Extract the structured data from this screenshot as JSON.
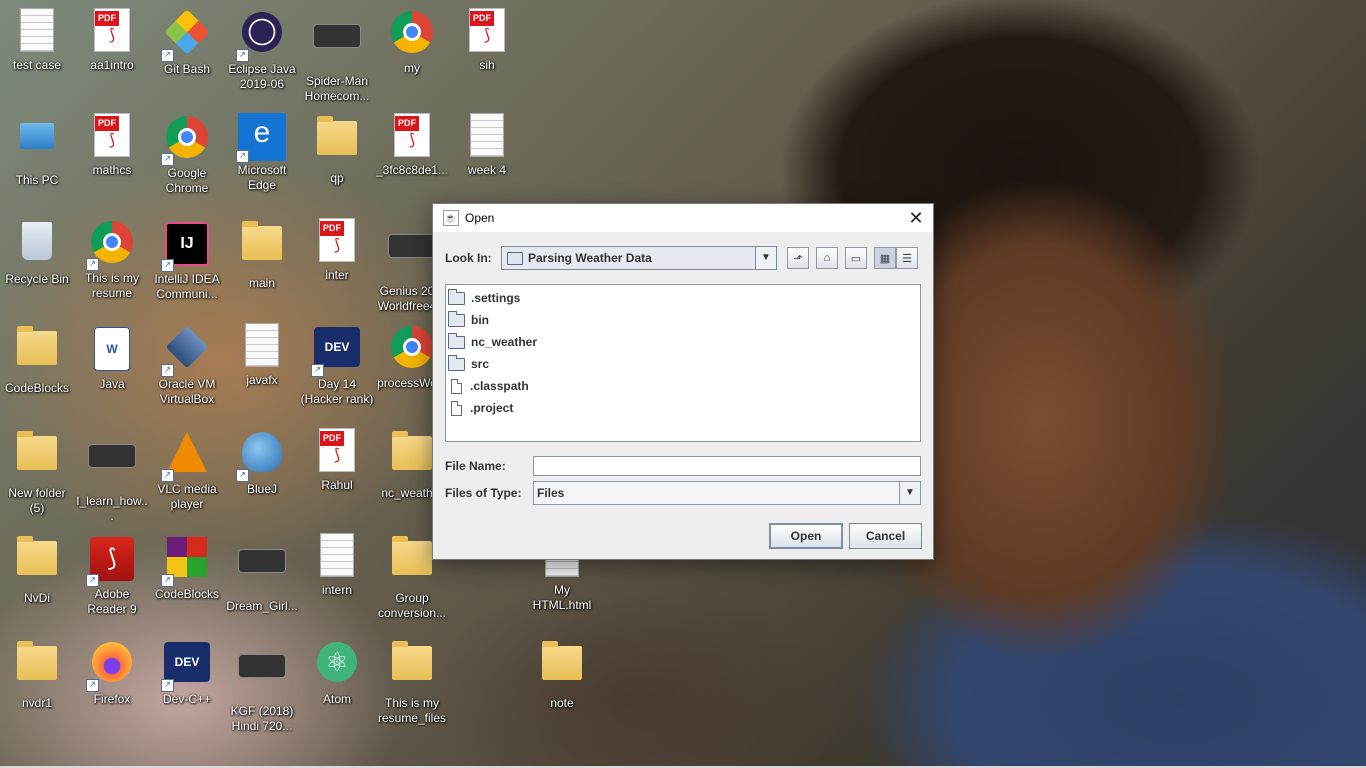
{
  "desktop": {
    "icons": [
      {
        "label": "test case",
        "type": "doc"
      },
      {
        "label": "aa1intro",
        "type": "pdf"
      },
      {
        "label": "Git Bash",
        "type": "git"
      },
      {
        "label": "Eclipse Java 2019-06",
        "type": "eclipse"
      },
      {
        "label": "Spider-Man Homecom...",
        "type": "video"
      },
      {
        "label": "my",
        "type": "chrome"
      },
      {
        "label": "sih",
        "type": "pdf"
      },
      {
        "label": "This PC",
        "type": "pc"
      },
      {
        "label": "mathcs",
        "type": "pdf"
      },
      {
        "label": "Google Chrome",
        "type": "chrome"
      },
      {
        "label": "Microsoft Edge",
        "type": "edge"
      },
      {
        "label": "qp",
        "type": "folder"
      },
      {
        "label": "_3fc8c8de1...",
        "type": "pdf"
      },
      {
        "label": "week 4",
        "type": "doc"
      },
      {
        "label": "Recycle Bin",
        "type": "recycle"
      },
      {
        "label": "This is my resume",
        "type": "chrome"
      },
      {
        "label": "IntelliJ IDEA Communi...",
        "type": "intellij"
      },
      {
        "label": "main",
        "type": "folder"
      },
      {
        "label": "inter",
        "type": "pdf"
      },
      {
        "label": "Genius 20... Worldfree4...",
        "type": "video"
      },
      {
        "label": "CodeBlocks",
        "type": "folder"
      },
      {
        "label": "Java",
        "type": "word"
      },
      {
        "label": "Oracle VM VirtualBox",
        "type": "vbox"
      },
      {
        "label": "javafx",
        "type": "doc"
      },
      {
        "label": "Day 14 (Hacker rank)",
        "type": "devcpp"
      },
      {
        "label": "processWo...",
        "type": "chrome"
      },
      {
        "label": "New folder (5)",
        "type": "folder"
      },
      {
        "label": "I_learn_how...",
        "type": "video"
      },
      {
        "label": "VLC media player",
        "type": "vlc"
      },
      {
        "label": "BlueJ",
        "type": "bluej"
      },
      {
        "label": "Rahul",
        "type": "pdf"
      },
      {
        "label": "nc_weath...",
        "type": "folder"
      },
      {
        "label": "NvDi",
        "type": "folder"
      },
      {
        "label": "Adobe Reader 9",
        "type": "adobe"
      },
      {
        "label": "CodeBlocks",
        "type": "codeblocks"
      },
      {
        "label": "Dream_Girl...",
        "type": "video"
      },
      {
        "label": "intern",
        "type": "doc"
      },
      {
        "label": "Group conversion...",
        "type": "folder"
      },
      {
        "label": "My HTML.html",
        "type": "doc"
      },
      {
        "label": "nvdr1",
        "type": "folder"
      },
      {
        "label": "Firefox",
        "type": "firefox"
      },
      {
        "label": "Dev-C++",
        "type": "devcpp"
      },
      {
        "label": "KGF (2018) Hindi 720...",
        "type": "video"
      },
      {
        "label": "Atom",
        "type": "atom"
      },
      {
        "label": "This is my resume_files",
        "type": "folder"
      },
      {
        "label": "note",
        "type": "folder"
      }
    ]
  },
  "dialog": {
    "title": "Open",
    "look_in_label": "Look In:",
    "look_in_value": "Parsing Weather Data",
    "files": [
      {
        "name": ".settings",
        "kind": "folder"
      },
      {
        "name": "bin",
        "kind": "folder"
      },
      {
        "name": "nc_weather",
        "kind": "folder"
      },
      {
        "name": "src",
        "kind": "folder"
      },
      {
        "name": ".classpath",
        "kind": "file"
      },
      {
        "name": ".project",
        "kind": "file"
      }
    ],
    "file_name_label": "File Name:",
    "file_name_value": "",
    "files_of_type_label": "Files of Type:",
    "files_of_type_value": "Files",
    "open_button": "Open",
    "cancel_button": "Cancel"
  }
}
